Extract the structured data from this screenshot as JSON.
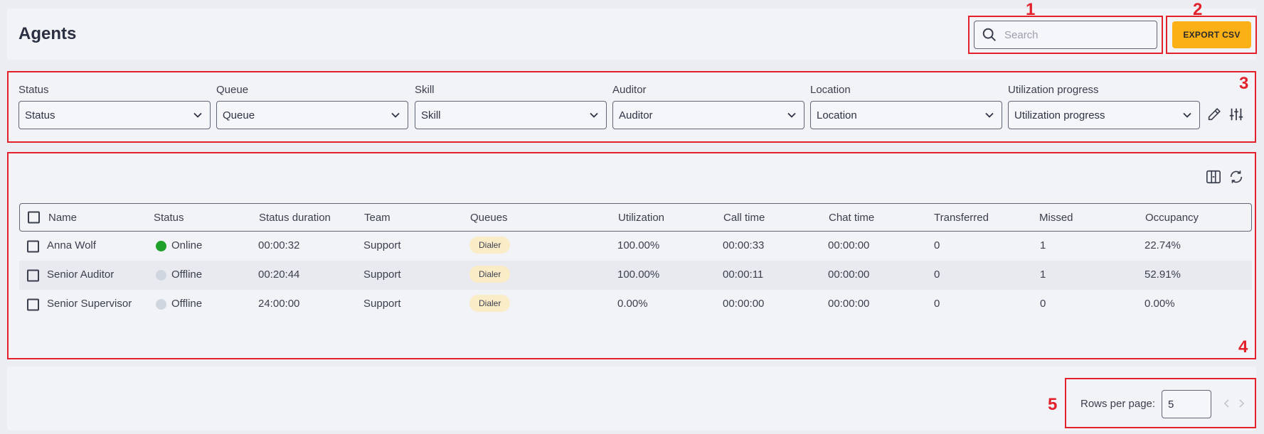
{
  "header": {
    "title": "Agents",
    "search_placeholder": "Search",
    "export_label": "EXPORT CSV"
  },
  "annotations": [
    "1",
    "2",
    "3",
    "4",
    "5"
  ],
  "filters": [
    {
      "label": "Status",
      "value": "Status"
    },
    {
      "label": "Queue",
      "value": "Queue"
    },
    {
      "label": "Skill",
      "value": "Skill"
    },
    {
      "label": "Auditor",
      "value": "Auditor"
    },
    {
      "label": "Location",
      "value": "Location"
    },
    {
      "label": "Utilization progress",
      "value": "Utilization progress"
    }
  ],
  "table": {
    "columns": [
      "Name",
      "Status",
      "Status duration",
      "Team",
      "Queues",
      "Utilization",
      "Call time",
      "Chat time",
      "Transferred",
      "Missed",
      "Occupancy"
    ],
    "rows": [
      {
        "name": "Anna Wolf",
        "status": "Online",
        "status_color": "#1fa02a",
        "duration": "00:00:32",
        "team": "Support",
        "queue": "Dialer",
        "utilization": "100.00%",
        "call_time": "00:00:33",
        "chat_time": "00:00:00",
        "transferred": "0",
        "missed": "1",
        "occupancy": "22.74%"
      },
      {
        "name": "Senior Auditor",
        "status": "Offline",
        "status_color": "#cfd6e0",
        "duration": "00:20:44",
        "team": "Support",
        "queue": "Dialer",
        "utilization": "100.00%",
        "call_time": "00:00:11",
        "chat_time": "00:00:00",
        "transferred": "0",
        "missed": "1",
        "occupancy": "52.91%"
      },
      {
        "name": "Senior Supervisor",
        "status": "Offline",
        "status_color": "#cfd6e0",
        "duration": "24:00:00",
        "team": "Support",
        "queue": "Dialer",
        "utilization": "0.00%",
        "call_time": "00:00:00",
        "chat_time": "00:00:00",
        "transferred": "0",
        "missed": "0",
        "occupancy": "0.00%"
      }
    ]
  },
  "pagination": {
    "rows_per_page_label": "Rows per page:",
    "rows_per_page_value": "5"
  },
  "colors": {
    "accent": "#fbb016",
    "annotation": "#e3212b",
    "online": "#1fa02a",
    "offline": "#cfd6e0",
    "badge": "#fbecc8"
  }
}
